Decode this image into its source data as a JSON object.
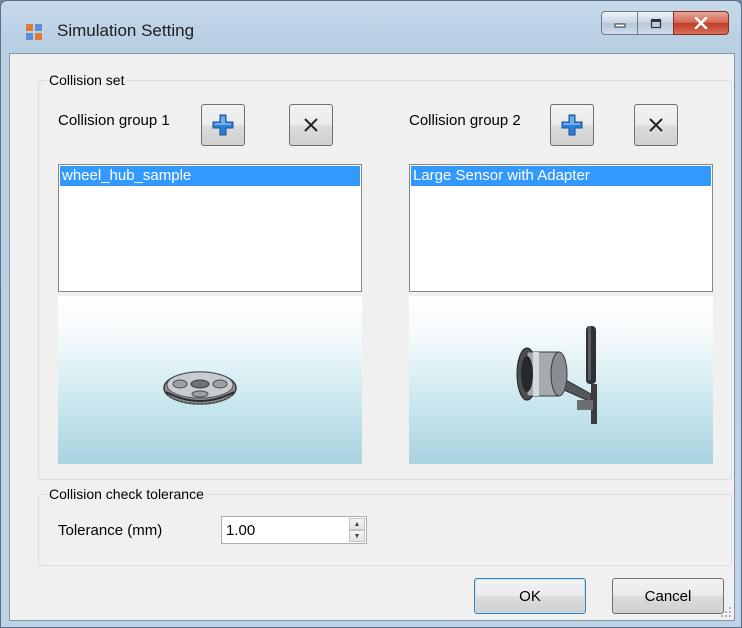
{
  "window": {
    "title": "Simulation Setting"
  },
  "collision_set": {
    "legend": "Collision set",
    "group1": {
      "label": "Collision group 1",
      "items": [
        "wheel_hub_sample"
      ]
    },
    "group2": {
      "label": "Collision group 2",
      "items": [
        "Large Sensor with Adapter"
      ]
    }
  },
  "tolerance": {
    "legend": "Collision check tolerance",
    "label": "Tolerance (mm)",
    "value": "1.00"
  },
  "buttons": {
    "ok": "OK",
    "cancel": "Cancel"
  },
  "colors": {
    "selection": "#3399ff",
    "add_icon_blue": "#1f6fd1",
    "close_button_red": "#c13b25",
    "preview_gradient_bottom": "#a9d3e0"
  },
  "icons": {
    "window_icon": "app-window-icon",
    "add": "plus-icon",
    "remove": "x-icon",
    "minimize": "minimize-icon",
    "maximize": "maximize-icon",
    "close": "close-icon"
  }
}
